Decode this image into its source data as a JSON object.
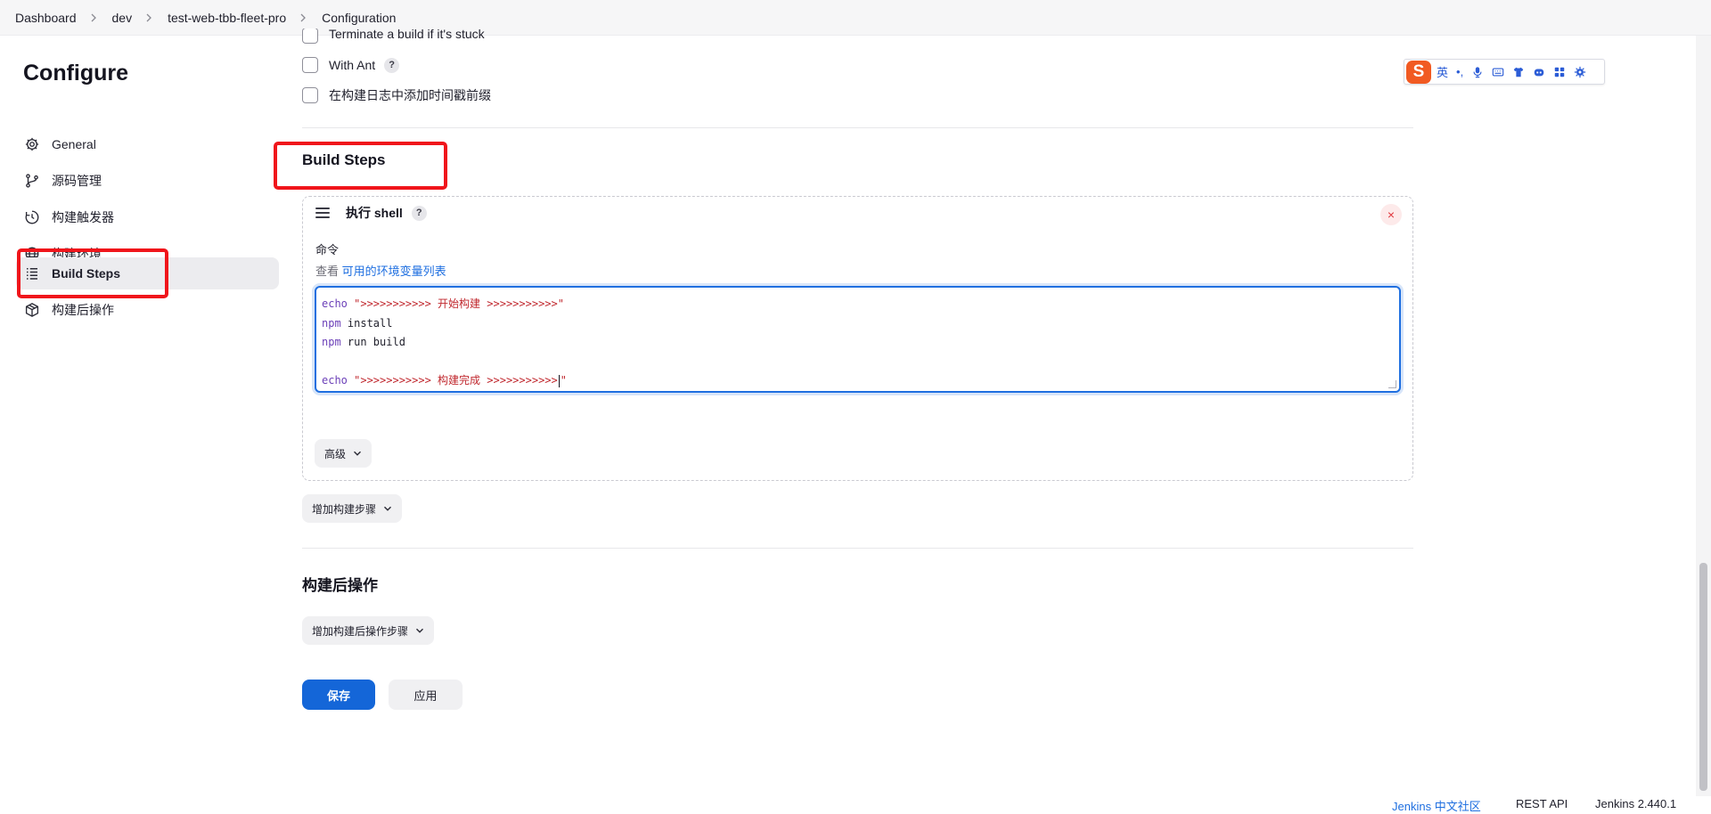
{
  "breadcrumb": [
    "Dashboard",
    "dev",
    "test-web-tbb-fleet-pro",
    "Configuration"
  ],
  "sidebar": {
    "title": "Configure",
    "items": [
      {
        "label": "General",
        "icon": "gear-icon"
      },
      {
        "label": "源码管理",
        "icon": "branch-icon"
      },
      {
        "label": "构建触发器",
        "icon": "clock-icon"
      },
      {
        "label": "构建环境",
        "icon": "globe-icon"
      },
      {
        "label": "Build Steps",
        "icon": "list-icon",
        "active": true
      },
      {
        "label": "构建后操作",
        "icon": "package-icon"
      }
    ]
  },
  "options": {
    "terminate_label": "Terminate a build if it's stuck",
    "with_ant_label": "With Ant",
    "timestamp_label": "在构建日志中添加时间戳前缀",
    "help": "?"
  },
  "build_steps": {
    "title": "Build Steps",
    "step_title": "执行 shell",
    "help": "?",
    "close": "×",
    "command_label": "命令",
    "env_prefix": "查看 ",
    "env_link": "可用的环境变量列表",
    "code_lines": [
      {
        "cmd": "echo",
        "rest": " \">>>>>>>>>>> 开始构建 >>>>>>>>>>>\"",
        "type": "str"
      },
      {
        "cmd": "npm",
        "rest": " install",
        "type": "plain"
      },
      {
        "cmd": "npm",
        "rest": " run build",
        "type": "plain"
      },
      {
        "cmd": "",
        "rest": "",
        "type": "plain"
      },
      {
        "cmd": "echo",
        "rest": " \">>>>>>>>>>> 构建完成 >>>>>>>>>>>",
        "tail": "\"",
        "type": "str"
      }
    ],
    "advanced_label": "高级",
    "add_step_label": "增加构建步骤"
  },
  "post_build": {
    "title": "构建后操作",
    "add_label": "增加构建后操作步骤"
  },
  "actions": {
    "save": "保存",
    "apply": "应用"
  },
  "footer": {
    "community": "Jenkins 中文社区",
    "rest_api": "REST API",
    "version": "Jenkins 2.440.1"
  },
  "ime": {
    "logo": "S",
    "lang": "英",
    "punct": "•,",
    "icons": [
      "microphone-icon",
      "keyboard-icon",
      "shirt-icon",
      "robot-icon",
      "grid-icon",
      "settings-icon"
    ]
  },
  "colors": {
    "accent": "#1466d8",
    "highlight": "#f0151b",
    "ime_brand": "#f15a22"
  }
}
